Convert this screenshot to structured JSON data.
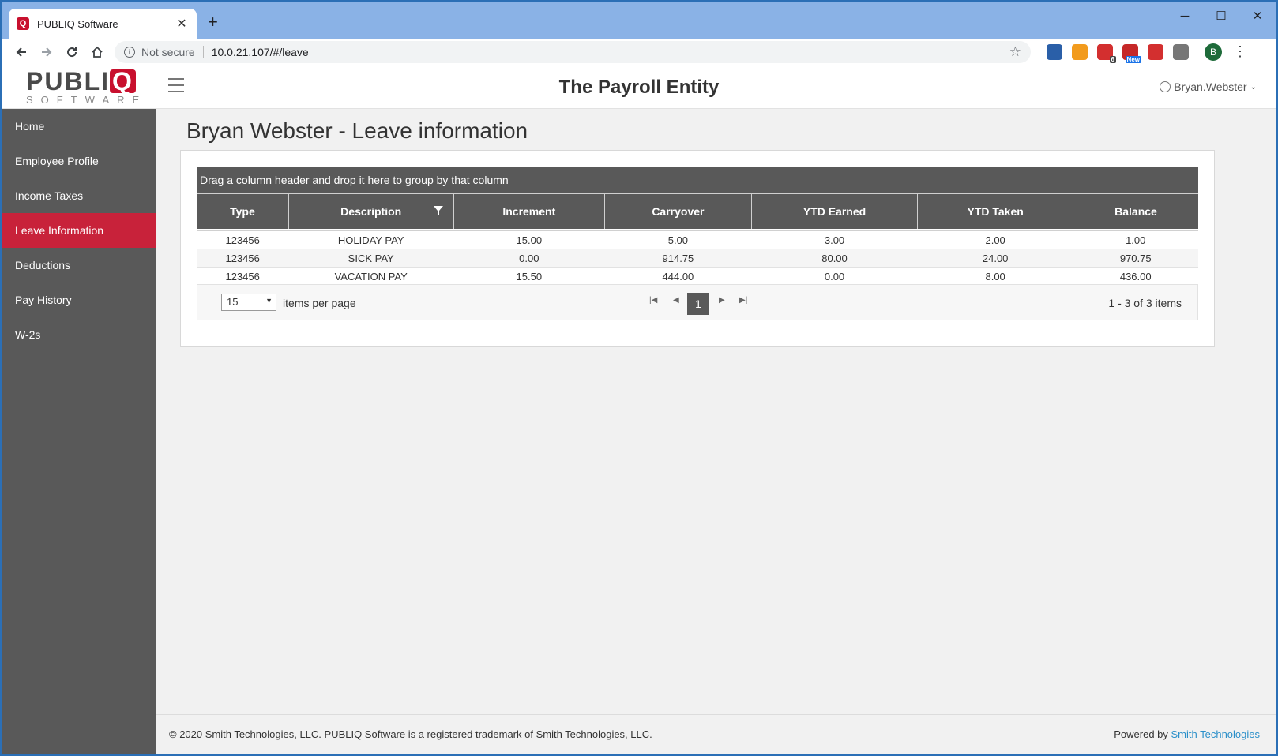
{
  "browser": {
    "tab_title": "PUBLIQ Software",
    "tab_favicon": "Q",
    "tab_close": "✕",
    "new_tab": "+",
    "window_controls": {
      "minimize": "─",
      "maximize": "☐",
      "close": "✕"
    },
    "security_text": "Not secure",
    "url": "10.0.21.107/#/leave",
    "profile_initial": "B",
    "extensions": [
      {
        "icon": "eyedropper-extension-icon",
        "color": "#2a5fa8"
      },
      {
        "icon": "rss-extension-icon",
        "color": "#f29b1d"
      },
      {
        "icon": "calendar-extension-icon",
        "color": "#d32f2f",
        "badge": "6"
      },
      {
        "icon": "ublock-extension-icon",
        "color": "#c62828",
        "badge": "New"
      },
      {
        "icon": "vivaldi-extension-icon",
        "color": "#d32f2f"
      },
      {
        "icon": "circle-extension-icon",
        "color": "#777777"
      }
    ]
  },
  "app": {
    "logo_main": "PUBLI",
    "logo_q": "Q",
    "logo_sub": "SOFTWARE",
    "entity_title": "The Payroll Entity",
    "user_name": "Bryan.Webster"
  },
  "sidebar": {
    "items": [
      {
        "label": "Home",
        "active": false
      },
      {
        "label": "Employee Profile",
        "active": false
      },
      {
        "label": "Income Taxes",
        "active": false
      },
      {
        "label": "Leave Information",
        "active": true
      },
      {
        "label": "Deductions",
        "active": false
      },
      {
        "label": "Pay History",
        "active": false
      },
      {
        "label": "W-2s",
        "active": false
      }
    ]
  },
  "main": {
    "heading": "Bryan Webster - Leave information",
    "group_hint": "Drag a column header and drop it here to group by that column",
    "columns": [
      "Type",
      "Description",
      "Increment",
      "Carryover",
      "YTD Earned",
      "YTD Taken",
      "Balance"
    ],
    "rows": [
      [
        "123456",
        "HOLIDAY PAY",
        "15.00",
        "5.00",
        "3.00",
        "2.00",
        "1.00"
      ],
      [
        "123456",
        "SICK PAY",
        "0.00",
        "914.75",
        "80.00",
        "24.00",
        "970.75"
      ],
      [
        "123456",
        "VACATION PAY",
        "15.50",
        "444.00",
        "0.00",
        "8.00",
        "436.00"
      ]
    ],
    "pager": {
      "page_size": "15",
      "items_per_page_label": "items per page",
      "current_page": "1",
      "info": "1 - 3 of 3 items"
    }
  },
  "footer": {
    "copyright": "© 2020 Smith Technologies, LLC. PUBLIQ Software is a registered trademark of Smith Technologies, LLC.",
    "powered_prefix": "Powered by ",
    "powered_link": "Smith Technologies"
  },
  "colors": {
    "brand_red": "#c8102e",
    "sidebar_bg": "#595959",
    "active_item": "#c8223a",
    "link_blue": "#2a8fc9"
  }
}
